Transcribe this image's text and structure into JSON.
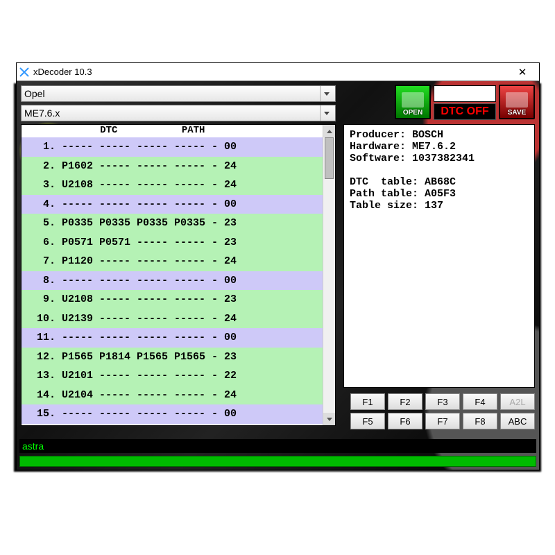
{
  "window": {
    "title": "xDecoder 10.3"
  },
  "combos": {
    "make": "Opel",
    "ecu": "ME7.6.x"
  },
  "actions": {
    "open": "OPEN",
    "dtc_off": "DTC OFF",
    "save": "SAVE"
  },
  "list": {
    "header": "             DTC           PATH",
    "rows": [
      {
        "n": " 1",
        "c1": "-----",
        "c2": "-----",
        "c3": "-----",
        "c4": "-----",
        "p": "00",
        "hl": "violet"
      },
      {
        "n": " 2",
        "c1": "P1602",
        "c2": "-----",
        "c3": "-----",
        "c4": "-----",
        "p": "24",
        "hl": "green"
      },
      {
        "n": " 3",
        "c1": "U2108",
        "c2": "-----",
        "c3": "-----",
        "c4": "-----",
        "p": "24",
        "hl": "green"
      },
      {
        "n": " 4",
        "c1": "-----",
        "c2": "-----",
        "c3": "-----",
        "c4": "-----",
        "p": "00",
        "hl": "violet"
      },
      {
        "n": " 5",
        "c1": "P0335",
        "c2": "P0335",
        "c3": "P0335",
        "c4": "P0335",
        "p": "23",
        "hl": "green"
      },
      {
        "n": " 6",
        "c1": "P0571",
        "c2": "P0571",
        "c3": "-----",
        "c4": "-----",
        "p": "23",
        "hl": "green"
      },
      {
        "n": " 7",
        "c1": "P1120",
        "c2": "-----",
        "c3": "-----",
        "c4": "-----",
        "p": "24",
        "hl": "green"
      },
      {
        "n": " 8",
        "c1": "-----",
        "c2": "-----",
        "c3": "-----",
        "c4": "-----",
        "p": "00",
        "hl": "violet"
      },
      {
        "n": " 9",
        "c1": "U2108",
        "c2": "-----",
        "c3": "-----",
        "c4": "-----",
        "p": "23",
        "hl": "green"
      },
      {
        "n": "10",
        "c1": "U2139",
        "c2": "-----",
        "c3": "-----",
        "c4": "-----",
        "p": "24",
        "hl": "green"
      },
      {
        "n": "11",
        "c1": "-----",
        "c2": "-----",
        "c3": "-----",
        "c4": "-----",
        "p": "00",
        "hl": "violet"
      },
      {
        "n": "12",
        "c1": "P1565",
        "c2": "P1814",
        "c3": "P1565",
        "c4": "P1565",
        "p": "23",
        "hl": "green"
      },
      {
        "n": "13",
        "c1": "U2101",
        "c2": "-----",
        "c3": "-----",
        "c4": "-----",
        "p": "22",
        "hl": "green"
      },
      {
        "n": "14",
        "c1": "U2104",
        "c2": "-----",
        "c3": "-----",
        "c4": "-----",
        "p": "24",
        "hl": "green"
      },
      {
        "n": "15",
        "c1": "-----",
        "c2": "-----",
        "c3": "-----",
        "c4": "-----",
        "p": "00",
        "hl": "violet"
      }
    ]
  },
  "info": {
    "producer_label": "Producer:",
    "producer": "BOSCH",
    "hardware_label": "Hardware:",
    "hardware": "ME7.6.2",
    "software_label": "Software:",
    "software": "1037382341",
    "dtc_table_label": "DTC  table:",
    "dtc_table": "AB68C",
    "path_table_label": "Path table:",
    "path_table": "A05F3",
    "table_size_label": "Table size:",
    "table_size": "137"
  },
  "fkeys": [
    "F1",
    "F2",
    "F3",
    "F4",
    "A2L",
    "F5",
    "F6",
    "F7",
    "F8",
    "ABC"
  ],
  "fkeys_disabled_index": 4,
  "status": "astra"
}
